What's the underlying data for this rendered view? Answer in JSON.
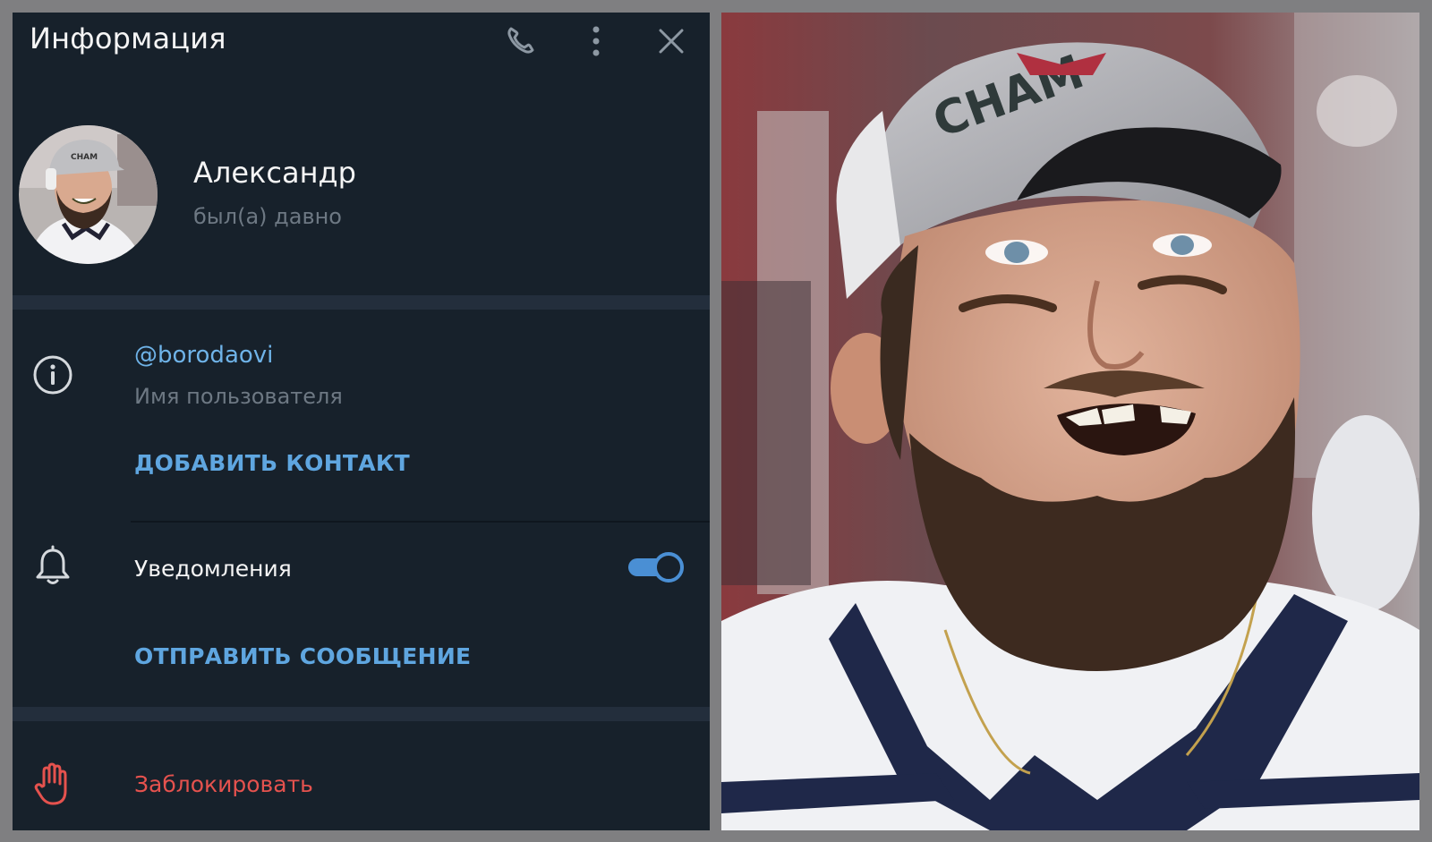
{
  "header": {
    "title": "Информация",
    "call_icon": "phone-icon",
    "menu_icon": "more-vertical-icon",
    "close_icon": "close-icon"
  },
  "profile": {
    "name": "Александр",
    "status": "был(а) давно"
  },
  "info": {
    "icon": "info-icon",
    "username": "@borodaovi",
    "username_label": "Имя пользователя",
    "add_contact": "ДОБАВИТЬ КОНТАКТ"
  },
  "notifications": {
    "icon": "bell-icon",
    "label": "Уведомления",
    "enabled": true,
    "send_message": "ОТПРАВИТЬ СООБЩЕНИЕ"
  },
  "block": {
    "icon": "hand-stop-icon",
    "label": "Заблокировать"
  },
  "photo": {
    "cap_text": "CHAM"
  },
  "colors": {
    "background": "#17212b",
    "separator": "#232e3c",
    "accent": "#5fa6e0",
    "danger": "#e5524e",
    "muted": "#6d7883",
    "frame": "#7f7f81"
  }
}
